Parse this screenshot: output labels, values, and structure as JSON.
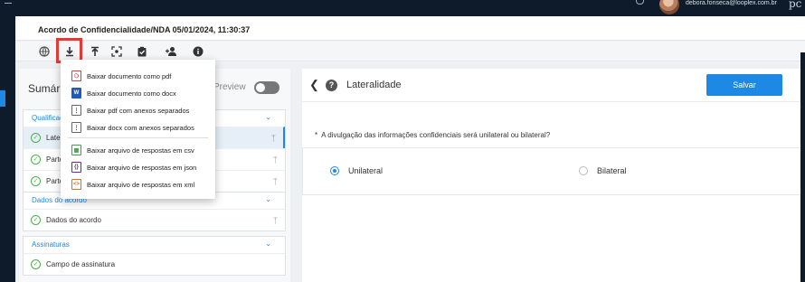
{
  "topbar": {
    "user_email": "debora.fonseca@looplex.com.br",
    "logo_fragment": "pc"
  },
  "header": {
    "document_title": "Acordo de Confidencialidade/NDA 05/01/2024, 11:30:37"
  },
  "toolbar": {
    "icons": [
      "globe-icon",
      "download-icon",
      "upload-icon",
      "capture-icon",
      "clipboard-check-icon",
      "add-user-icon",
      "info-icon"
    ]
  },
  "download_menu": {
    "items": [
      {
        "label": "Baixar documento como pdf",
        "icon": "pdf-icon",
        "color": "#e53935"
      },
      {
        "label": "Baixar documento como docx",
        "icon": "word-icon",
        "color": "#1e5bbf"
      },
      {
        "label": "Baixar pdf com anexos separados",
        "icon": "zip-icon",
        "color": "#444444"
      },
      {
        "label": "Baixar docx com anexos separados",
        "icon": "zip-icon",
        "color": "#444444"
      },
      {
        "label": "Baixar arquivo de respostas em csv",
        "icon": "csv-icon",
        "color": "#43a047"
      },
      {
        "label": "Baixar arquivo de respostas em json",
        "icon": "json-icon",
        "color": "#7b1fa2"
      },
      {
        "label": "Baixar arquivo de respostas em xml",
        "icon": "xml-icon",
        "color": "#ef6c00"
      }
    ]
  },
  "summary": {
    "title": "Sumário",
    "preview_label": "Preview",
    "preview_enabled": false,
    "sections": [
      {
        "title": "Qualificação",
        "rows": [
          "Lateralidade",
          "Parte Reveladora",
          "Parte Receptora"
        ]
      },
      {
        "title": "Dados do acordo",
        "rows": [
          "Dados do acordo"
        ]
      },
      {
        "title": "Assinaturas",
        "rows": [
          "Campo de assinatura"
        ]
      }
    ]
  },
  "question_panel": {
    "title": "Lateralidade",
    "save_label": "Salvar",
    "question_marker": "*",
    "question": "A divulgação das informações confidenciais será unilateral ou bilateral?",
    "options": [
      {
        "label": "Unilateral",
        "selected": true
      },
      {
        "label": "Bilateral",
        "selected": false
      }
    ]
  },
  "colors": {
    "accent": "#1e88e5",
    "navbar": "#0d1b2a",
    "check": "#4caf50",
    "highlight": "#e53935"
  }
}
